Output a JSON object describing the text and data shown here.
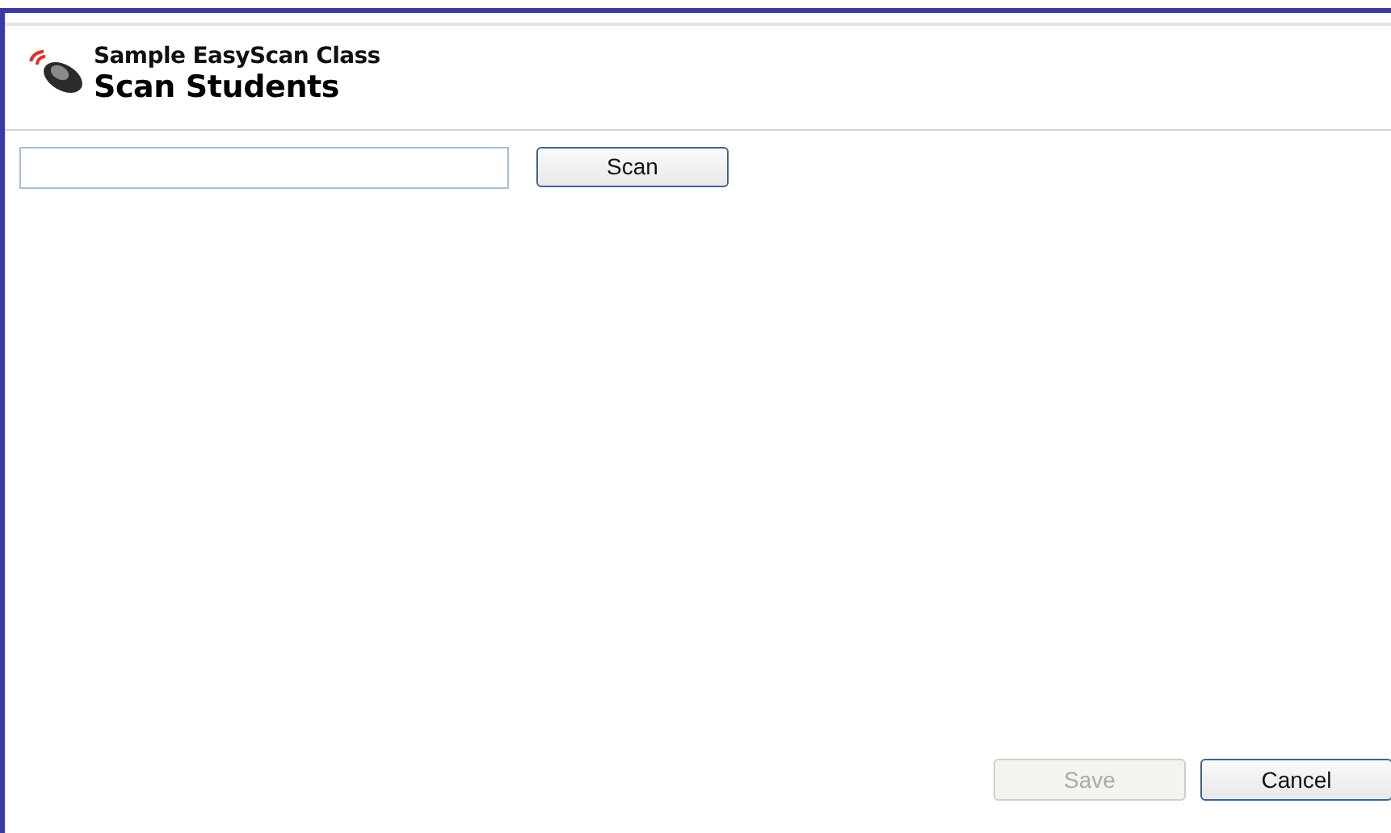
{
  "header": {
    "class_name": "Sample EasyScan Class",
    "title": "Scan Students"
  },
  "scan": {
    "button": "Scan"
  },
  "buttons": [
    {
      "label": "Save",
      "disabled": true
    },
    {
      "label": "Cancel",
      "disabled": false
    }
  ]
}
